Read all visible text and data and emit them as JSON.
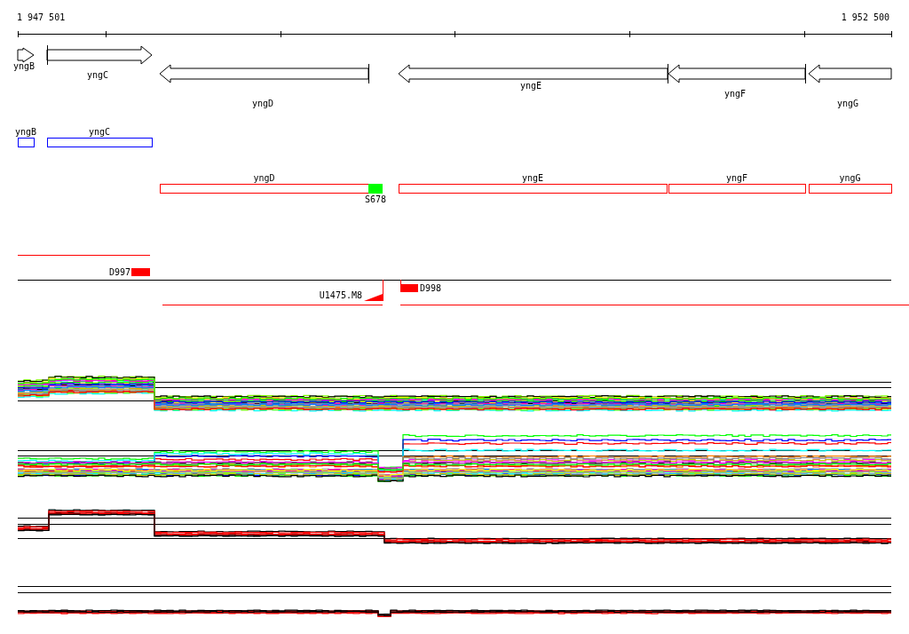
{
  "ruler": {
    "start": "1 947 501",
    "end": "1 952 500"
  },
  "genes": [
    {
      "name": "yngB",
      "kind": "forward"
    },
    {
      "name": "yngC",
      "kind": "forward"
    },
    {
      "name": "yngD",
      "kind": "reverse"
    },
    {
      "name": "yngE",
      "kind": "reverse"
    },
    {
      "name": "yngF",
      "kind": "reverse"
    },
    {
      "name": "yngG",
      "kind": "reverse"
    }
  ],
  "cds": [
    {
      "name": "yngB",
      "kind": "gene",
      "color": "#0000ff"
    },
    {
      "name": "yngC",
      "kind": "gene",
      "color": "#0000ff"
    },
    {
      "name": "yngD",
      "kind": "gene",
      "color": "#ff0000"
    },
    {
      "name": "S678",
      "kind": "site",
      "color": "#00ff00"
    },
    {
      "name": "yngE",
      "kind": "gene",
      "color": "#ff0000"
    },
    {
      "name": "yngF",
      "kind": "gene",
      "color": "#ff0000"
    },
    {
      "name": "yngG",
      "kind": "gene",
      "color": "#ff0000"
    }
  ],
  "transcripts": [
    {
      "label": "D997",
      "kind": "block"
    },
    {
      "label": "U1475.M8",
      "kind": "ramp"
    },
    {
      "label": "D998",
      "kind": "block"
    }
  ]
}
